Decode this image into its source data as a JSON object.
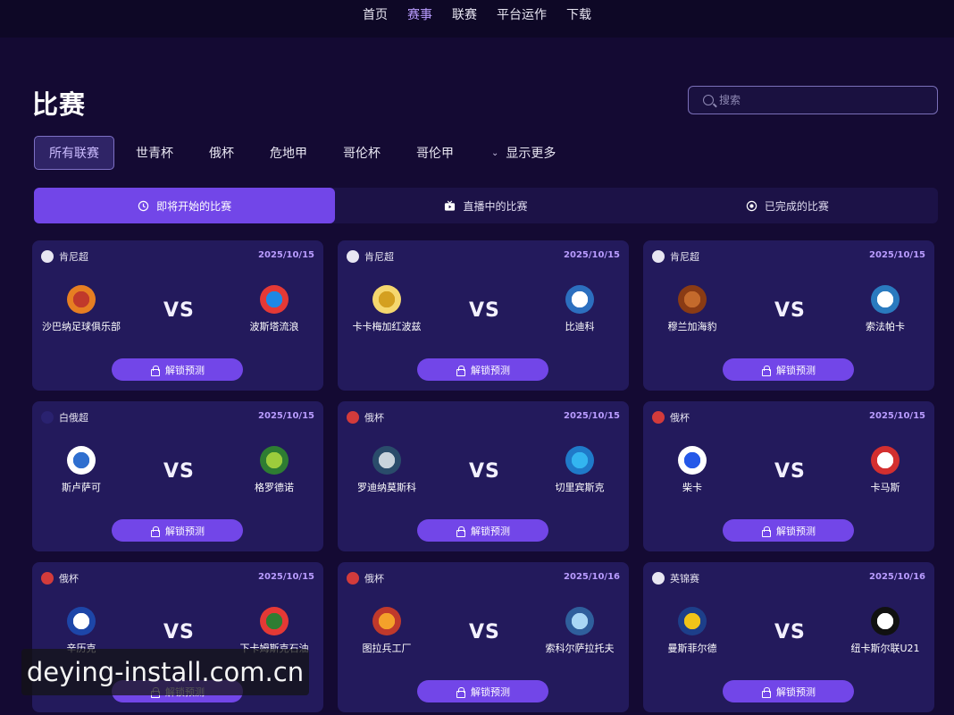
{
  "topnav": {
    "items": [
      {
        "label": "首页",
        "active": false
      },
      {
        "label": "赛事",
        "active": true
      },
      {
        "label": "联赛",
        "active": false
      },
      {
        "label": "平台运作",
        "active": false
      },
      {
        "label": "下载",
        "active": false
      }
    ]
  },
  "page": {
    "title": "比赛"
  },
  "search": {
    "placeholder": "搜索",
    "icon": "search-icon"
  },
  "leagues": {
    "items": [
      "所有联赛",
      "世青杯",
      "俄杯",
      "危地甲",
      "哥伦杯",
      "哥伦甲"
    ],
    "more_label": "显示更多",
    "active_index": 0
  },
  "tabs": [
    {
      "label": "即将开始的比赛",
      "icon": "clock-icon",
      "active": true
    },
    {
      "label": "直播中的比赛",
      "icon": "tv-icon",
      "active": false
    },
    {
      "label": "已完成的比赛",
      "icon": "radio-dot-icon",
      "active": false
    }
  ],
  "colors": {
    "accent": "#7246e8",
    "background": "#140a33",
    "card": "#231a5c",
    "date": "#b99cff"
  },
  "vs_label": "VS",
  "unlock_label": "解锁预测",
  "matches": [
    {
      "league": "肯尼超",
      "date": "2025/10/15",
      "home": "沙巴纳足球俱乐部",
      "away": "波斯塔流浪"
    },
    {
      "league": "肯尼超",
      "date": "2025/10/15",
      "home": "卡卡梅加红波兹",
      "away": "比迪科"
    },
    {
      "league": "肯尼超",
      "date": "2025/10/15",
      "home": "穆兰加海豹",
      "away": "索法帕卡"
    },
    {
      "league": "白俄超",
      "date": "2025/10/15",
      "home": "斯卢萨可",
      "away": "格罗德诺"
    },
    {
      "league": "俄杯",
      "date": "2025/10/15",
      "home": "罗迪纳莫斯科",
      "away": "切里宾斯克"
    },
    {
      "league": "俄杯",
      "date": "2025/10/15",
      "home": "柴卡",
      "away": "卡马斯"
    },
    {
      "league": "俄杯",
      "date": "2025/10/15",
      "home": "辛历克",
      "away": "下卡姆斯克石油"
    },
    {
      "league": "俄杯",
      "date": "2025/10/16",
      "home": "图拉兵工厂",
      "away": "索科尔萨拉托夫"
    },
    {
      "league": "英锦赛",
      "date": "2025/10/16",
      "home": "曼斯菲尔德",
      "away": "纽卡斯尔联U21"
    }
  ],
  "watermark": "deying-install.com.cn"
}
